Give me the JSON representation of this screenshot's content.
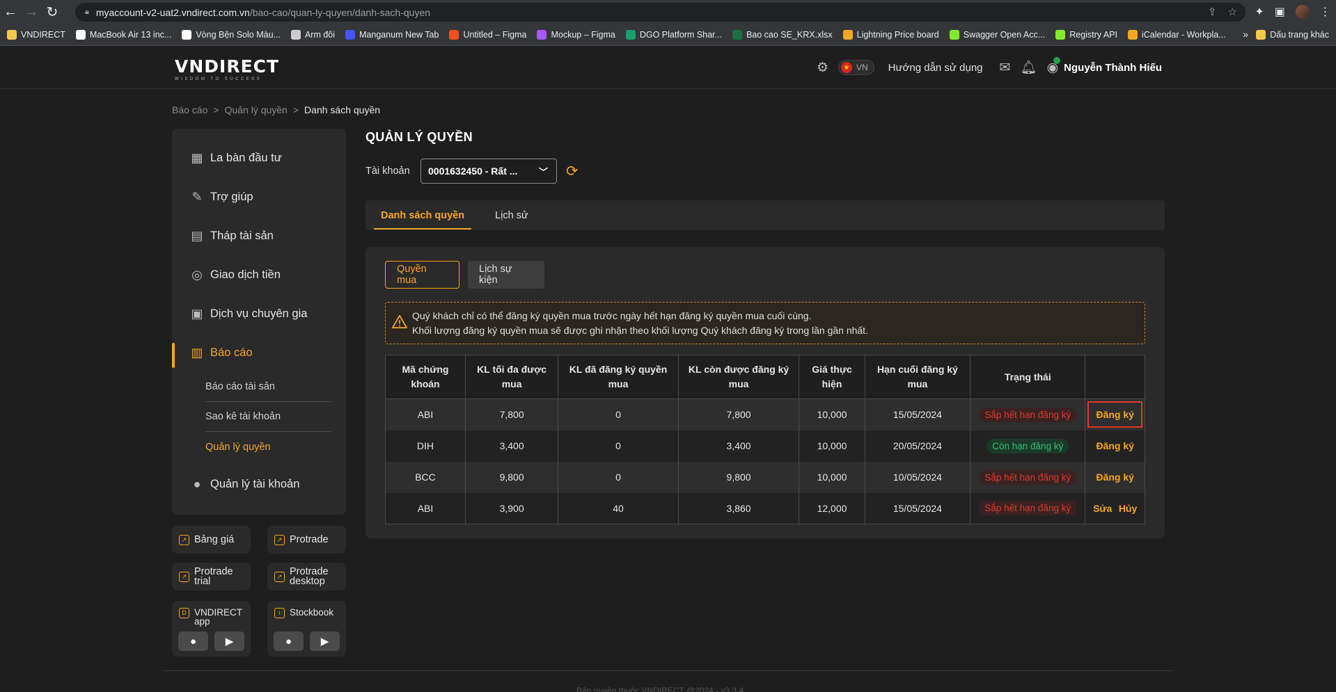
{
  "browser": {
    "url_host": "myaccount-v2-uat2.vndirect.com.vn",
    "url_path": "/bao-cao/quan-ly-quyen/danh-sach-quyen",
    "bookmarks": [
      {
        "label": "VNDIRECT",
        "color": "#f2c94c"
      },
      {
        "label": "MacBook Air 13 inc...",
        "color": "#ffffff"
      },
      {
        "label": "Vòng Bện Solo Màu...",
        "color": "#ffffff"
      },
      {
        "label": "Arm đôi",
        "color": "#cccccc"
      },
      {
        "label": "Manganum New Tab",
        "color": "#4355ff"
      },
      {
        "label": "Untitled – Figma",
        "color": "#f24e1e"
      },
      {
        "label": "Mockup – Figma",
        "color": "#a259ff"
      },
      {
        "label": "DGO Platform Shar...",
        "color": "#1a9e6f"
      },
      {
        "label": "Bao cao SE_KRX.xlsx",
        "color": "#1d6f42"
      },
      {
        "label": "Lightning Price board",
        "color": "#f5a623"
      },
      {
        "label": "Swagger Open Acc...",
        "color": "#85ea2d"
      },
      {
        "label": "Registry API",
        "color": "#85ea2d"
      },
      {
        "label": "iCalendar - Workpla...",
        "color": "#f5a623"
      }
    ],
    "bookmark_more": "»",
    "bookmark_folder": "Dấu trang khác"
  },
  "header": {
    "logo": "VNDIRECT",
    "logo_tagline": "WISDOM TO SUCCESS",
    "lang": "VN",
    "guide": "Hướng dẫn sử dụng",
    "user_name": "Nguyễn Thành Hiếu"
  },
  "breadcrumb": {
    "items": [
      "Báo cáo",
      "Quản lý quyền"
    ],
    "current": "Danh sách quyền",
    "sep": ">"
  },
  "sidebar": {
    "items": [
      {
        "label": "La bàn đầu tư"
      },
      {
        "label": "Trợ giúp"
      },
      {
        "label": "Tháp tài sản"
      },
      {
        "label": "Giao dịch tiền"
      },
      {
        "label": "Dịch vụ chuyên gia"
      },
      {
        "label": "Báo cáo"
      },
      {
        "label": "Quản lý tài khoản"
      }
    ],
    "sub_items": [
      {
        "label": "Báo cáo tài sản"
      },
      {
        "label": "Sao kê tài khoản"
      },
      {
        "label": "Quản lý quyền"
      }
    ]
  },
  "quick_links": {
    "bang_gia": "Bảng giá",
    "protrade": "Protrade",
    "protrade_trial_1": "Protrade",
    "protrade_trial_2": "trial",
    "protrade_desktop_1": "Protrade",
    "protrade_desktop_2": "desktop",
    "vnd_app_1": "VNDIRECT",
    "vnd_app_2": "app",
    "stockbook": "Stockbook"
  },
  "main": {
    "title": "QUẢN LÝ QUYỀN",
    "account_label": "Tài khoản",
    "account_value": "0001632450 - Rất ...",
    "tabs": [
      {
        "label": "Danh sách quyền"
      },
      {
        "label": "Lịch sử"
      }
    ],
    "subtabs": [
      {
        "label": "Quyền mua"
      },
      {
        "label": "Lịch sự kiện"
      }
    ],
    "notice_line1": "Quý khách chỉ có thể đăng ký quyền mua trước ngày hết hạn đăng ký quyền mua cuối cùng.",
    "notice_line2": "Khối lượng đăng ký quyền mua sẽ được ghi nhận theo khối lượng Quý khách đăng ký trong lần gần nhất."
  },
  "table": {
    "headers": [
      [
        "Mã chứng",
        "khoán"
      ],
      [
        "KL tối đa được",
        "mua"
      ],
      [
        "KL đã đăng ký quyền",
        "mua"
      ],
      [
        "KL còn được đăng ký",
        "mua"
      ],
      [
        "Giá thực",
        "hiện"
      ],
      [
        "Hạn cuối đăng ký",
        "mua"
      ],
      [
        "Trạng thái"
      ],
      [
        ""
      ]
    ],
    "rows": [
      {
        "code": "ABI",
        "max": "7,800",
        "registered": "0",
        "remaining": "7,800",
        "price": "10,000",
        "deadline": "15/05/2024",
        "status": "Sắp hết hạn đăng ký",
        "status_type": "warn",
        "actions": [
          "Đăng ký"
        ]
      },
      {
        "code": "DIH",
        "max": "3,400",
        "registered": "0",
        "remaining": "3,400",
        "price": "10,000",
        "deadline": "20/05/2024",
        "status": "Còn hạn đăng ký",
        "status_type": "ok",
        "actions": [
          "Đăng ký"
        ]
      },
      {
        "code": "BCC",
        "max": "9,800",
        "registered": "0",
        "remaining": "9,800",
        "price": "10,000",
        "deadline": "10/05/2024",
        "status": "Sắp hết hạn đăng ký",
        "status_type": "warn",
        "actions": [
          "Đăng ký"
        ]
      },
      {
        "code": "ABI",
        "max": "3,900",
        "registered": "40",
        "remaining": "3,860",
        "price": "12,000",
        "deadline": "15/05/2024",
        "status": "Sắp hết hạn đăng ký",
        "status_type": "warn",
        "actions": [
          "Sửa",
          "Hủy"
        ]
      }
    ]
  },
  "footer": "Bản quyền thuộc VNDIRECT @2024 - v3.3.4",
  "colors": {
    "accent": "#f5a623",
    "danger": "#e0392b",
    "success": "#2fbf71"
  }
}
